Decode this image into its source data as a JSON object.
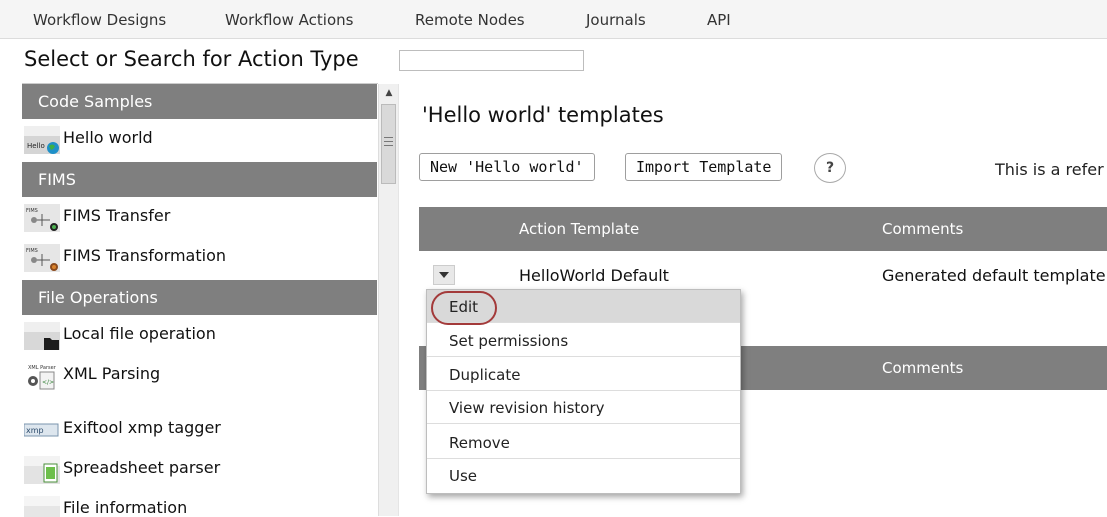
{
  "nav": {
    "items": [
      "Workflow Designs",
      "Workflow Actions",
      "Remote Nodes",
      "Journals",
      "API"
    ]
  },
  "search": {
    "label": "Select or Search for Action Type",
    "value": ""
  },
  "sidebar": {
    "categories": [
      {
        "name": "Code Samples",
        "actions": [
          "Hello world"
        ]
      },
      {
        "name": "FIMS",
        "actions": [
          "FIMS Transfer",
          "FIMS Transformation"
        ]
      },
      {
        "name": "File Operations",
        "actions": [
          "Local file operation",
          "XML Parsing",
          "Exiftool xmp tagger",
          "Spreadsheet parser",
          "File information"
        ]
      }
    ],
    "thumb_texts": {
      "hello": "Hello",
      "fims": "FIMS",
      "xmp": "xmp",
      "xml": "XML Parser"
    }
  },
  "main": {
    "title": "'Hello world' templates",
    "new_button": "New 'Hello world'",
    "import_button": "Import Template",
    "help_label": "?",
    "reference_text": "This is a refer"
  },
  "table": {
    "headers": {
      "action_template": "Action Template",
      "comments": "Comments"
    },
    "rows": [
      {
        "template": "HelloWorld Default",
        "comment": "Generated default template"
      }
    ],
    "second_header_comments": "Comments"
  },
  "context_menu": {
    "items": [
      "Edit",
      "Set permissions",
      "Duplicate",
      "View revision history",
      "Remove",
      "Use"
    ],
    "active": "Edit"
  },
  "colors": {
    "header_gray": "#7f7f7f",
    "highlight_ring": "#a33a3a",
    "menu_active": "#d9d9d9"
  }
}
